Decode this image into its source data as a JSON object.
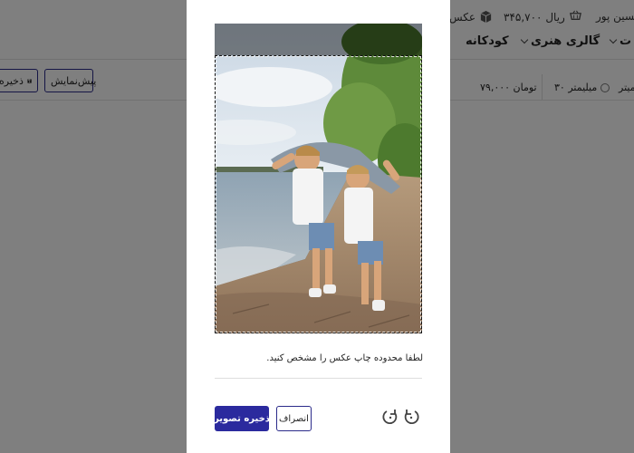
{
  "header": {
    "user_name": "حسین پور",
    "cart_amount": "۳۴۵,۷۰۰ ریال",
    "box_label": "عکس",
    "nav": [
      {
        "label": "کودکانه"
      },
      {
        "label": "گالری هنری"
      },
      {
        "label": "ت"
      }
    ]
  },
  "toolbar": {
    "preview_label": "پیش‌نمایش",
    "save_label": "ذخیره"
  },
  "size_options": {
    "price": "۷۹,۰۰۰ تومان",
    "size_30": "۳۰ میلیمتر",
    "size_other": "میتر"
  },
  "modal": {
    "hint": "لطفا محدوده چاپ عکس را مشخص کنید.",
    "cancel_label": "انصراف",
    "save_image_label": "ذخیره تصویر"
  },
  "colors": {
    "accent": "#2b2a9e",
    "overlay": "#00000080"
  },
  "icons": {
    "cart": "cart-icon",
    "box": "box-icon",
    "save": "floppy-icon",
    "rotate_right": "rotate-right-icon",
    "rotate_left": "rotate-left-icon"
  }
}
